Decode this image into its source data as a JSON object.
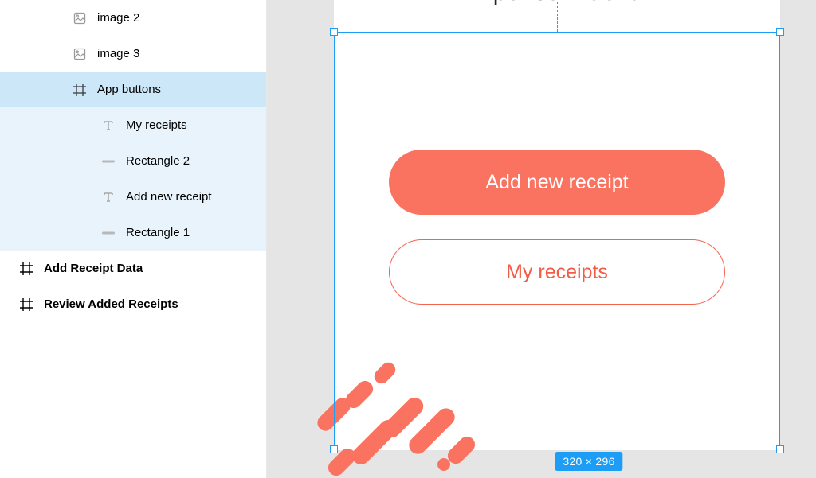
{
  "layers": {
    "items": [
      {
        "icon": "image-icon",
        "label": "image 2",
        "depth": 1,
        "sel": 0
      },
      {
        "icon": "image-icon",
        "label": "image 3",
        "depth": 1,
        "sel": 0
      },
      {
        "icon": "frame-icon",
        "label": "App buttons",
        "depth": 1,
        "sel": 1
      },
      {
        "icon": "text-icon",
        "label": "My receipts",
        "depth": 2,
        "sel": 2
      },
      {
        "icon": "shape-icon",
        "label": "Rectangle 2",
        "depth": 2,
        "sel": 2
      },
      {
        "icon": "text-icon",
        "label": "Add new receipt",
        "depth": 2,
        "sel": 2
      },
      {
        "icon": "shape-icon",
        "label": "Rectangle 1",
        "depth": 2,
        "sel": 2
      }
    ],
    "roots": [
      {
        "icon": "frame-icon",
        "label": "Add Receipt Data"
      },
      {
        "icon": "frame-icon",
        "label": "Review Added Receipts"
      }
    ]
  },
  "artboard": {
    "title": "Expense Tracker",
    "primary_button": "Add new receipt",
    "secondary_button": "My receipts"
  },
  "selection": {
    "dimensions": "320 × 296"
  },
  "colors": {
    "accent": "#f97360",
    "selection": "#1e9df7"
  }
}
